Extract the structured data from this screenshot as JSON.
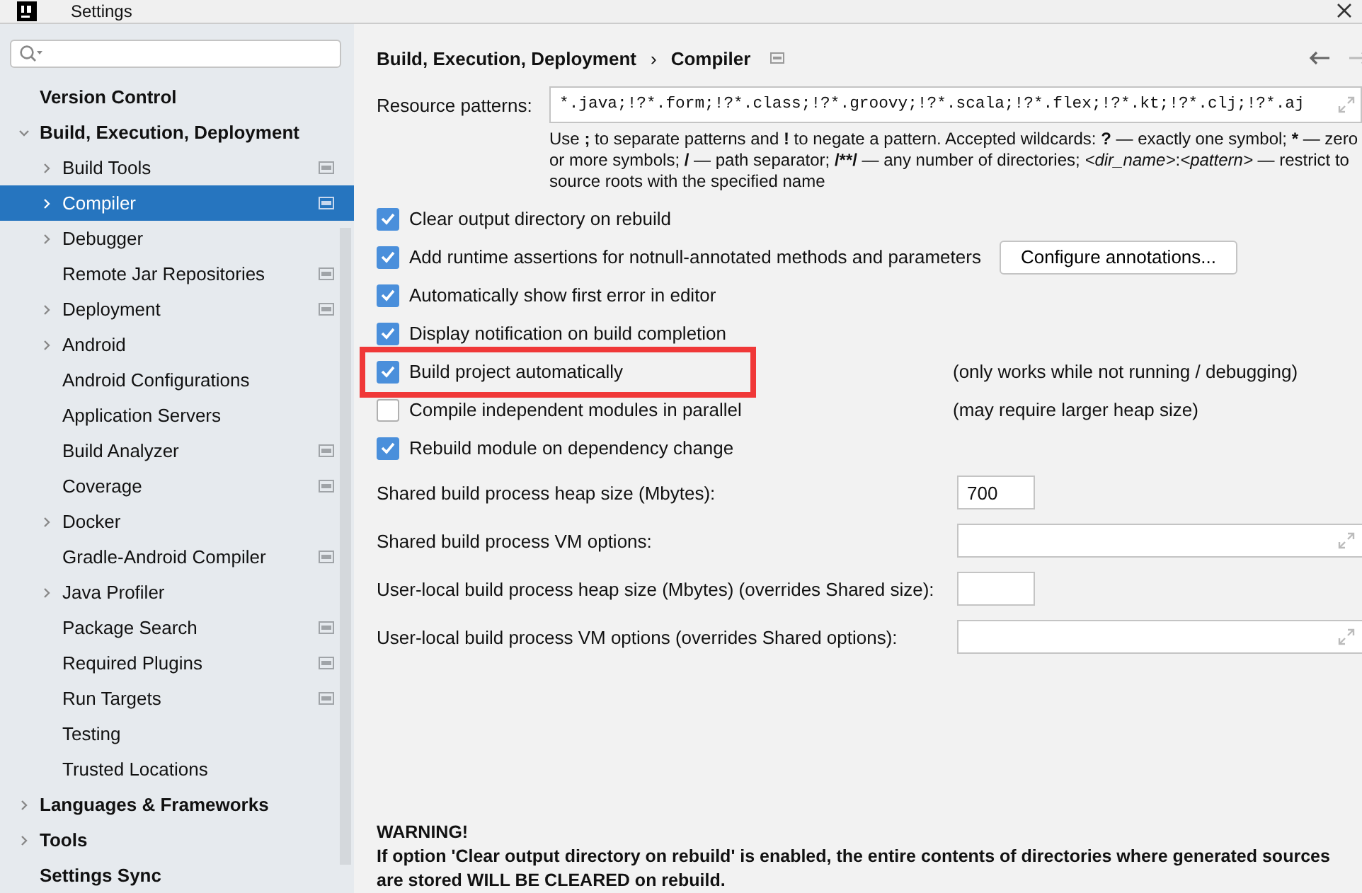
{
  "window": {
    "title": "Settings"
  },
  "sidebar": {
    "items": [
      {
        "label": "Version Control",
        "expandable": false,
        "selected": false,
        "badge": false
      },
      {
        "label": "Build, Execution, Deployment",
        "expandable": true,
        "expanded": true,
        "selected": false,
        "badge": false,
        "children": [
          {
            "label": "Build Tools",
            "expandable": true,
            "expanded": false,
            "selected": false,
            "badge": true
          },
          {
            "label": "Compiler",
            "expandable": true,
            "expanded": false,
            "selected": true,
            "badge": true
          },
          {
            "label": "Debugger",
            "expandable": true,
            "expanded": false,
            "selected": false,
            "badge": false
          },
          {
            "label": "Remote Jar Repositories",
            "expandable": false,
            "selected": false,
            "badge": true
          },
          {
            "label": "Deployment",
            "expandable": true,
            "expanded": false,
            "selected": false,
            "badge": true
          },
          {
            "label": "Android",
            "expandable": true,
            "expanded": false,
            "selected": false,
            "badge": false
          },
          {
            "label": "Android Configurations",
            "expandable": false,
            "selected": false,
            "badge": false
          },
          {
            "label": "Application Servers",
            "expandable": false,
            "selected": false,
            "badge": false
          },
          {
            "label": "Build Analyzer",
            "expandable": false,
            "selected": false,
            "badge": true
          },
          {
            "label": "Coverage",
            "expandable": false,
            "selected": false,
            "badge": true
          },
          {
            "label": "Docker",
            "expandable": true,
            "expanded": false,
            "selected": false,
            "badge": false
          },
          {
            "label": "Gradle-Android Compiler",
            "expandable": false,
            "selected": false,
            "badge": true
          },
          {
            "label": "Java Profiler",
            "expandable": true,
            "expanded": false,
            "selected": false,
            "badge": false
          },
          {
            "label": "Package Search",
            "expandable": false,
            "selected": false,
            "badge": true
          },
          {
            "label": "Required Plugins",
            "expandable": false,
            "selected": false,
            "badge": true
          },
          {
            "label": "Run Targets",
            "expandable": false,
            "selected": false,
            "badge": true
          },
          {
            "label": "Testing",
            "expandable": false,
            "selected": false,
            "badge": false
          },
          {
            "label": "Trusted Locations",
            "expandable": false,
            "selected": false,
            "badge": false
          }
        ]
      },
      {
        "label": "Languages & Frameworks",
        "expandable": true,
        "expanded": false,
        "selected": false,
        "badge": false
      },
      {
        "label": "Tools",
        "expandable": true,
        "expanded": false,
        "selected": false,
        "badge": false
      },
      {
        "label": "Settings Sync",
        "expandable": false,
        "selected": false,
        "badge": false
      }
    ]
  },
  "breadcrumb": {
    "items": [
      "Build, Execution, Deployment",
      "Compiler"
    ],
    "separator": "›",
    "badge": true
  },
  "nav": {
    "back_disabled": false,
    "forward_disabled": true
  },
  "resource_patterns": {
    "label": "Resource patterns:",
    "value": "*.java;!?*.form;!?*.class;!?*.groovy;!?*.scala;!?*.flex;!?*.kt;!?*.clj;!?*.aj",
    "hint": [
      {
        "text": "Use ",
        "kind": "text"
      },
      {
        "text": ";",
        "kind": "symbol"
      },
      {
        "text": " to separate patterns and ",
        "kind": "text"
      },
      {
        "text": "!",
        "kind": "symbol"
      },
      {
        "text": " to negate a pattern. Accepted wildcards: ",
        "kind": "text"
      },
      {
        "text": "?",
        "kind": "symbol"
      },
      {
        "text": " — exactly one symbol; ",
        "kind": "text"
      },
      {
        "text": "*",
        "kind": "symbol"
      },
      {
        "text": " — zero or more symbols; ",
        "kind": "text"
      },
      {
        "text": "/",
        "kind": "symbol"
      },
      {
        "text": " — path separator; ",
        "kind": "text"
      },
      {
        "text": "/**/",
        "kind": "symbol"
      },
      {
        "text": " — any number of directories;  ",
        "kind": "text"
      },
      {
        "text": "<dir_name>",
        "kind": "placeholder"
      },
      {
        "text": ":",
        "kind": "text"
      },
      {
        "text": "<pattern>",
        "kind": "placeholder"
      },
      {
        "text": " — restrict to source roots with the specified name",
        "kind": "text"
      }
    ]
  },
  "options": [
    {
      "label": "Clear output directory on rebuild",
      "checked": true,
      "highlighted": false
    },
    {
      "label": "Add runtime assertions for notnull-annotated methods and parameters",
      "checked": true,
      "highlighted": false,
      "button": "Configure annotations..."
    },
    {
      "label": "Automatically show first error in editor",
      "checked": true,
      "highlighted": false
    },
    {
      "label": "Display notification on build completion",
      "checked": true,
      "highlighted": false
    },
    {
      "label": "Build project automatically",
      "checked": true,
      "highlighted": true,
      "note": "(only works while not running / debugging)"
    },
    {
      "label": "Compile independent modules in parallel",
      "checked": false,
      "highlighted": false,
      "note": "(may require larger heap size)"
    },
    {
      "label": "Rebuild module on dependency change",
      "checked": true,
      "highlighted": false
    }
  ],
  "fields": [
    {
      "label": "Shared build process heap size (Mbytes):",
      "kind": "short",
      "value": "700"
    },
    {
      "label": "Shared build process VM options:",
      "kind": "expandable"
    },
    {
      "label": "User-local build process heap size (Mbytes) (overrides Shared size):",
      "kind": "short"
    },
    {
      "label": "User-local build process VM options (overrides Shared options):",
      "kind": "expandable"
    }
  ],
  "warning": {
    "title": "WARNING!",
    "body": "If option 'Clear output directory on rebuild' is enabled, the entire contents of directories where generated sources are stored WILL BE CLEARED on rebuild."
  }
}
